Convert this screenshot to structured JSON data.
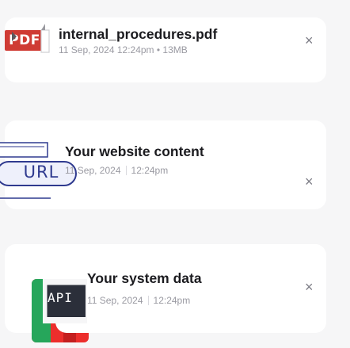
{
  "files": [
    {
      "icon_label": "PDF",
      "icon_name": "pdf-file-icon",
      "title": "internal_procedures.pdf",
      "meta": "11 Sep, 2024   12:24pm • 13MB"
    },
    {
      "icon_label": "URL",
      "icon_name": "url-link-icon",
      "title": "Your website content",
      "date": "11 Sep, 2024",
      "time": "12:24pm"
    },
    {
      "icon_label": "API",
      "icon_name": "api-icon",
      "title": "Your system data",
      "date": "11 Sep, 2024",
      "time": "12:24pm"
    }
  ],
  "remove_icon": "×",
  "colors": {
    "pdf_red": "#cf3b34",
    "url_blue": "#2f3a8f",
    "api_red": "#ec2e2c",
    "api_green": "#26a65b"
  }
}
